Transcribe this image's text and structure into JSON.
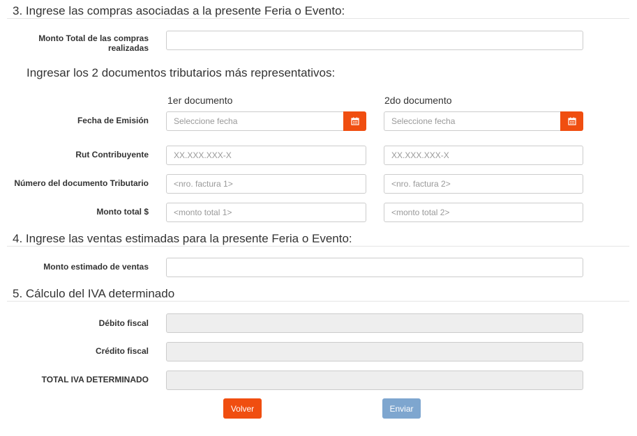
{
  "section3": {
    "title": "3. Ingrese las compras asociadas a la presente Feria o Evento:",
    "monto_total_label": "Monto Total de las compras realizadas",
    "monto_total_value": "",
    "subheading": "Ingresar los 2 documentos tributarios más representativos:",
    "col1_heading": "1er documento",
    "col2_heading": "2do documento",
    "fecha_label": "Fecha de Emisión",
    "fecha1_placeholder": "Seleccione fecha",
    "fecha2_placeholder": "Seleccione fecha",
    "rut_label": "Rut Contribuyente",
    "rut1_placeholder": "XX.XXX.XXX-X",
    "rut2_placeholder": "XX.XXX.XXX-X",
    "numero_label": "Número del documento Tributario",
    "numero1_placeholder": "<nro. factura 1>",
    "numero2_placeholder": "<nro. factura 2>",
    "monto_doc_label": "Monto total $",
    "monto1_placeholder": "<monto total 1>",
    "monto2_placeholder": "<monto total 2>"
  },
  "section4": {
    "title": "4. Ingrese las ventas estimadas para la presente Feria o Evento:",
    "monto_estimado_label": "Monto estimado de ventas",
    "monto_estimado_value": ""
  },
  "section5": {
    "title": "5. Cálculo del IVA determinado",
    "debito_label": "Débito fiscal",
    "credito_label": "Crédito fiscal",
    "total_label": "TOTAL IVA DETERMINADO"
  },
  "buttons": {
    "volver": "Volver",
    "enviar": "Enviar"
  },
  "icons": {
    "calendar": "calendar-icon"
  },
  "colors": {
    "accent": "#f04e10",
    "secondary": "#7ea6cf",
    "readonly_bg": "#eeeeee"
  }
}
